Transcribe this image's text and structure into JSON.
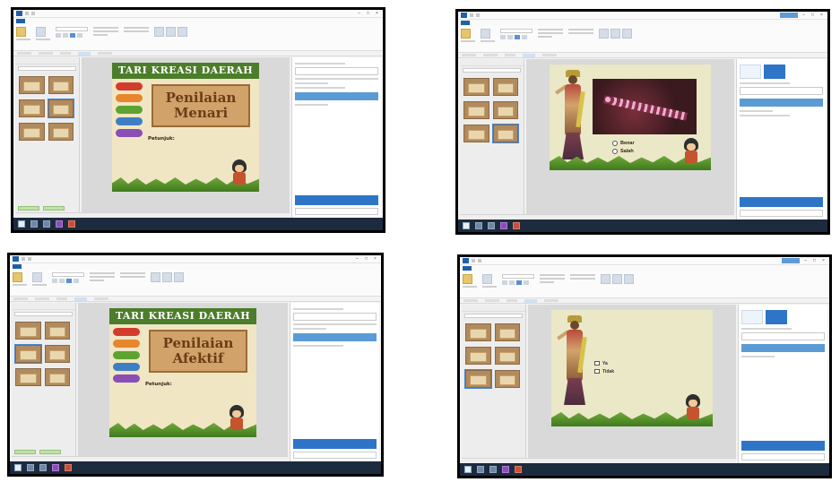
{
  "panels": [
    {
      "title_bar": "",
      "slide": {
        "header": "TARI KREASI DAERAH",
        "box_line1": "Penilaian",
        "box_line2": "Menari",
        "text_heading": "Petunjuk:",
        "text_body": ""
      }
    },
    {
      "title_bar": "",
      "slide": {
        "caption": "",
        "options": [
          "Benar",
          "Salah"
        ]
      }
    },
    {
      "title_bar": "",
      "slide": {
        "header": "TARI KREASI DAERAH",
        "box_line1": "Penilaian",
        "box_line2": "Afektif",
        "text_heading": "Petunjuk:",
        "text_body": ""
      }
    },
    {
      "title_bar": "",
      "slide": {
        "question": "",
        "options": [
          "Ya",
          "Tidak"
        ]
      }
    }
  ],
  "colors": {
    "slide_header": "#4c7d2a",
    "ribbon_accent": "#1f5fa8",
    "selection": "#2e75c7",
    "taskbar": "#1d2b3f"
  },
  "icons": [
    "app-icon",
    "start-icon",
    "explorer-icon",
    "powerpoint-icon",
    "presenter-icon"
  ]
}
